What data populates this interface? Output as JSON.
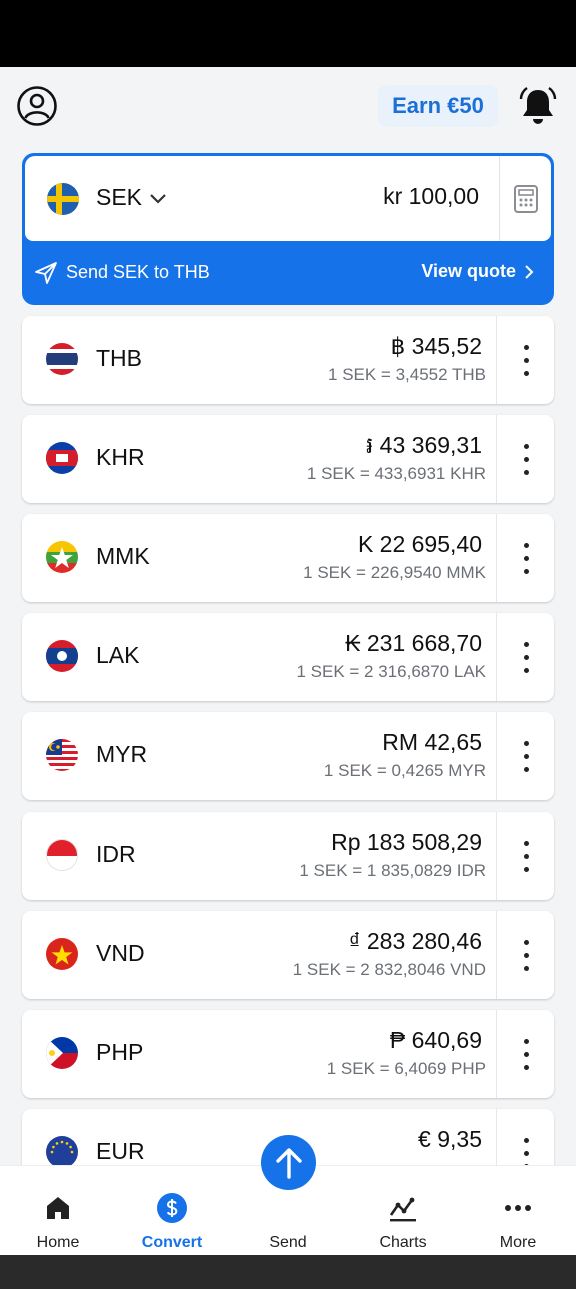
{
  "header": {
    "earn_label": "Earn €50"
  },
  "source": {
    "currency": "SEK",
    "amount": "kr 100,00",
    "send_label": "Send SEK to THB",
    "quote_label": "View quote"
  },
  "rates": [
    {
      "code": "THB",
      "amount": "฿ 345,52",
      "rate": "1 SEK = 3,4552 THB",
      "flag": "thailand-flag"
    },
    {
      "code": "KHR",
      "amount": "៛ 43 369,31",
      "rate": "1 SEK = 433,6931 KHR",
      "flag": "cambodia-flag"
    },
    {
      "code": "MMK",
      "amount": "K 22 695,40",
      "rate": "1 SEK = 226,9540 MMK",
      "flag": "myanmar-flag"
    },
    {
      "code": "LAK",
      "amount": "₭ 231 668,70",
      "rate": "1 SEK = 2 316,6870 LAK",
      "flag": "laos-flag"
    },
    {
      "code": "MYR",
      "amount": "RM 42,65",
      "rate": "1 SEK = 0,4265 MYR",
      "flag": "malaysia-flag"
    },
    {
      "code": "IDR",
      "amount": "Rp 183 508,29",
      "rate": "1 SEK = 1 835,0829 IDR",
      "flag": "indonesia-flag"
    },
    {
      "code": "VND",
      "amount": "₫ 283 280,46",
      "rate": "1 SEK = 2 832,8046 VND",
      "flag": "vietnam-flag"
    },
    {
      "code": "PHP",
      "amount": "₱ 640,69",
      "rate": "1 SEK = 6,4069 PHP",
      "flag": "philippines-flag"
    },
    {
      "code": "EUR",
      "amount": "€ 9,35",
      "rate": "",
      "flag": "eu-flag"
    }
  ],
  "nav": {
    "home": "Home",
    "convert": "Convert",
    "send": "Send",
    "charts": "Charts",
    "more": "More"
  },
  "colors": {
    "accent": "#1572e8",
    "earn_bg": "#e9f1fb"
  }
}
